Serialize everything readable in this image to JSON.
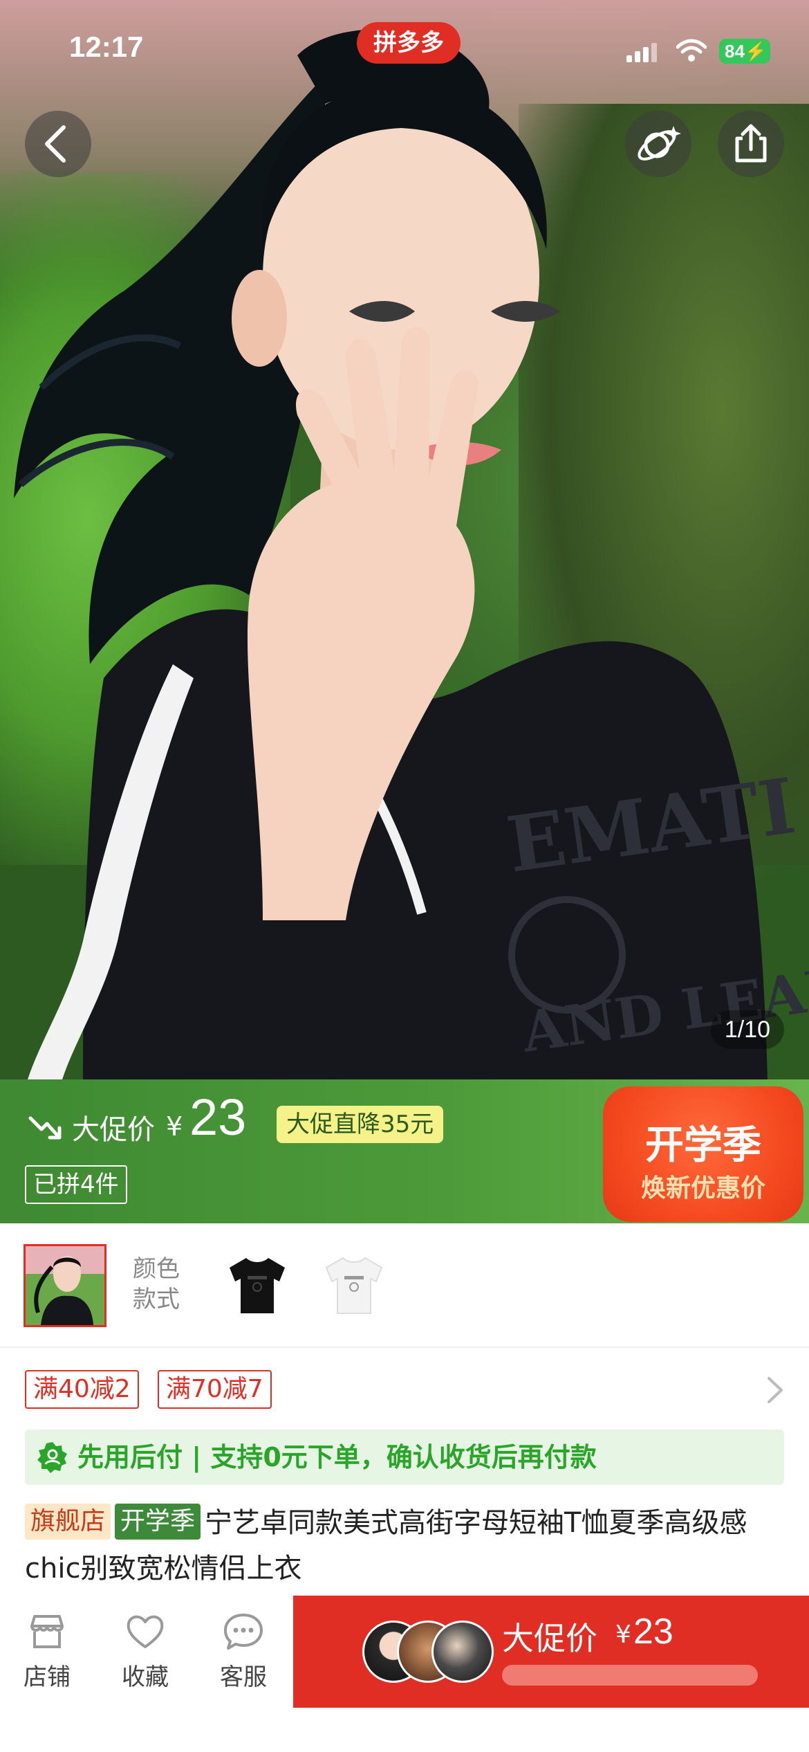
{
  "status_bar": {
    "time": "12:17",
    "battery": "84"
  },
  "app": {
    "logo_text": "拼多多"
  },
  "gallery": {
    "counter": "1/10"
  },
  "promo": {
    "label": "大促价",
    "currency": "¥",
    "price": "23",
    "discount_tag": "大促直降35元",
    "sold": "已拼4件",
    "season_title": "开学季",
    "season_sub": "焕新优惠价"
  },
  "options": {
    "label_line1": "颜色",
    "label_line2": "款式"
  },
  "coupons": [
    "满40减2",
    "满70减7"
  ],
  "pay_later": {
    "text": "先用后付 | 支持0元下单，确认收货后再付款"
  },
  "title": {
    "tag_flagship": "旗舰店",
    "tag_season": "开学季",
    "text": "宁艺卓同款美式高街字母短袖T恤夏季高级感chic别致宽松情侣上衣"
  },
  "bottom_nav": {
    "shop": "店铺",
    "favorite": "收藏",
    "service": "客服",
    "buy_label": "大促价",
    "buy_currency": "¥",
    "buy_price": "23"
  },
  "colors": {
    "accent_red": "#e02e24",
    "promo_green": "#4d9a3a",
    "pay_green": "#2aa52a"
  }
}
